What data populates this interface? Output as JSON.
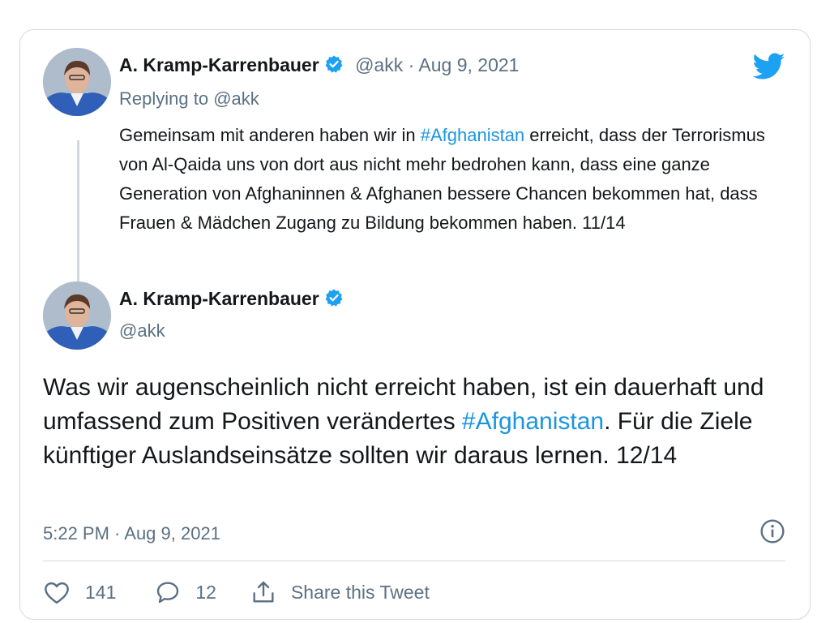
{
  "reply_tweet": {
    "author_name": "A. Kramp-Karrenbauer",
    "handle": "@akk",
    "separator": " · ",
    "date": "Aug 9, 2021",
    "replying_to_label": "Replying to ",
    "replying_to_handle": "@akk",
    "text_before_hashtag": "Gemeinsam mit anderen haben wir in ",
    "hashtag": "#Afghanistan",
    "text_after_hashtag": " erreicht, dass der Terrorismus von Al-Qaida uns von dort aus nicht mehr bedrohen kann, dass eine ganze Generation von Afghaninnen & Afghanen bessere Chancen bekommen hat, dass Frauen & Mädchen Zugang zu Bildung bekommen haben. 11/14"
  },
  "main_tweet": {
    "author_name": "A. Kramp-Karrenbauer",
    "handle": "@akk",
    "text_before_hashtag": "Was wir augenscheinlich nicht erreicht haben, ist ein dauerhaft und umfassend zum Positiven verändertes ",
    "hashtag": "#Afghanistan",
    "text_after_hashtag": ". Für die Ziele künftiger Auslandseinsätze sollten wir daraus lernen. 12/14",
    "timestamp": "5:22 PM · Aug 9, 2021"
  },
  "actions": {
    "like_count": "141",
    "reply_count": "12",
    "share_label": "Share this Tweet"
  },
  "colors": {
    "link": "#1b95e0",
    "verified": "#1da1f2",
    "muted": "#5b7083"
  },
  "icons": [
    "twitter-logo-icon",
    "verified-badge-icon",
    "info-icon",
    "heart-icon",
    "comment-icon",
    "share-icon"
  ]
}
